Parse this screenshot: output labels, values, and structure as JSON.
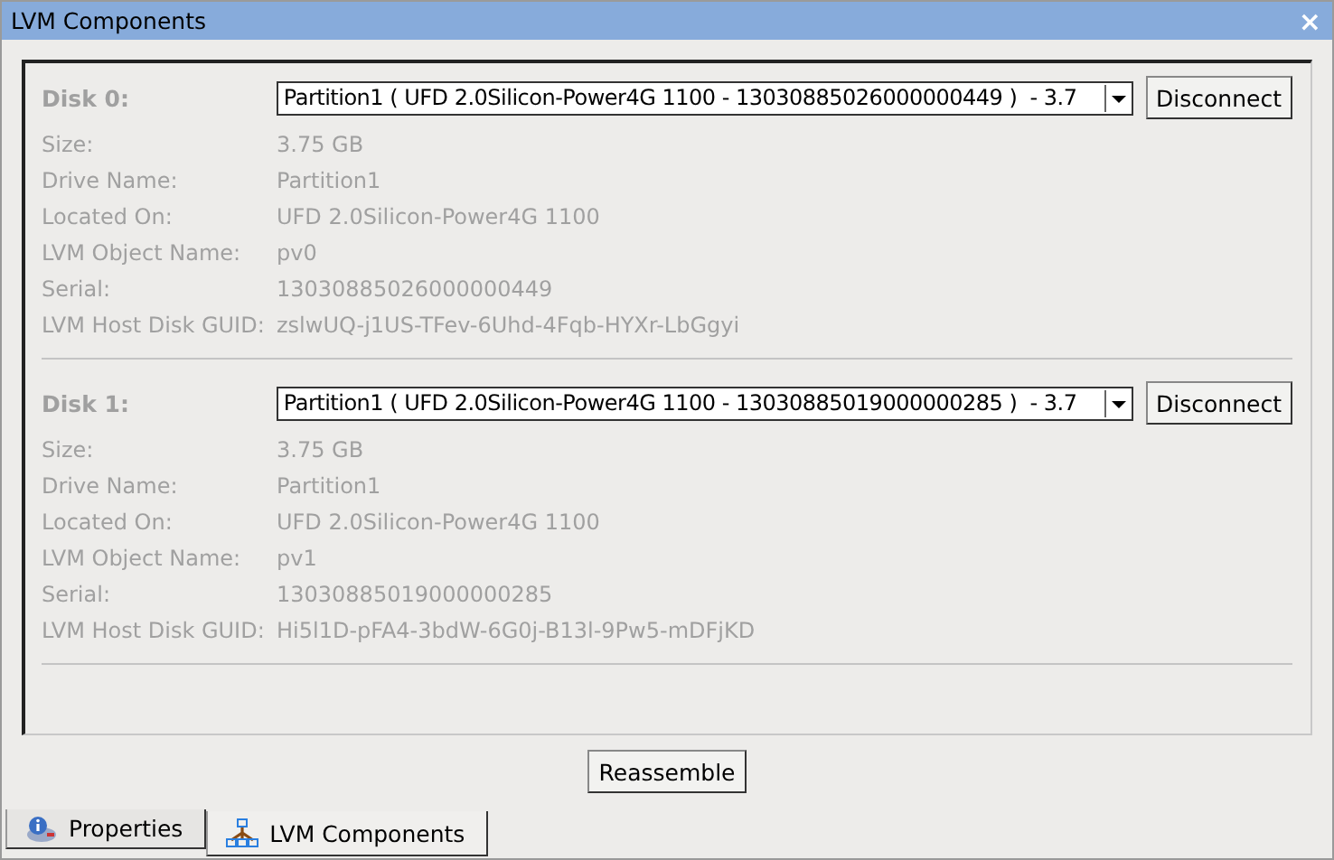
{
  "window": {
    "title": "LVM Components",
    "close": "×"
  },
  "disks": [
    {
      "label": "Disk 0:",
      "selection": "Partition1 ( UFD 2.0Silicon-Power4G 1100 - 13030885026000000449 )  - 3.7",
      "button": "Disconnect",
      "fields": [
        {
          "label": "Size:",
          "value": "3.75 GB"
        },
        {
          "label": "Drive Name:",
          "value": "Partition1"
        },
        {
          "label": "Located On:",
          "value": "UFD 2.0Silicon-Power4G 1100"
        },
        {
          "label": "LVM Object Name:",
          "value": "pv0"
        },
        {
          "label": "Serial:",
          "value": "13030885026000000449"
        },
        {
          "label": "LVM Host Disk GUID:",
          "value": "zslwUQ-j1US-TFev-6Uhd-4Fqb-HYXr-LbGgyi"
        }
      ]
    },
    {
      "label": "Disk 1:",
      "selection": "Partition1 ( UFD 2.0Silicon-Power4G 1100 - 13030885019000000285 )  - 3.7",
      "button": "Disconnect",
      "fields": [
        {
          "label": "Size:",
          "value": "3.75 GB"
        },
        {
          "label": "Drive Name:",
          "value": "Partition1"
        },
        {
          "label": "Located On:",
          "value": "UFD 2.0Silicon-Power4G 1100"
        },
        {
          "label": "LVM Object Name:",
          "value": "pv1"
        },
        {
          "label": "Serial:",
          "value": "13030885019000000285"
        },
        {
          "label": "LVM Host Disk GUID:",
          "value": "Hi5l1D-pFA4-3bdW-6G0j-B13l-9Pw5-mDFjKD"
        }
      ]
    }
  ],
  "action": "Reassemble",
  "tabs": [
    {
      "label": "Properties",
      "kind": "properties",
      "selected": false
    },
    {
      "label": "LVM Components",
      "kind": "lvm",
      "selected": true
    }
  ]
}
